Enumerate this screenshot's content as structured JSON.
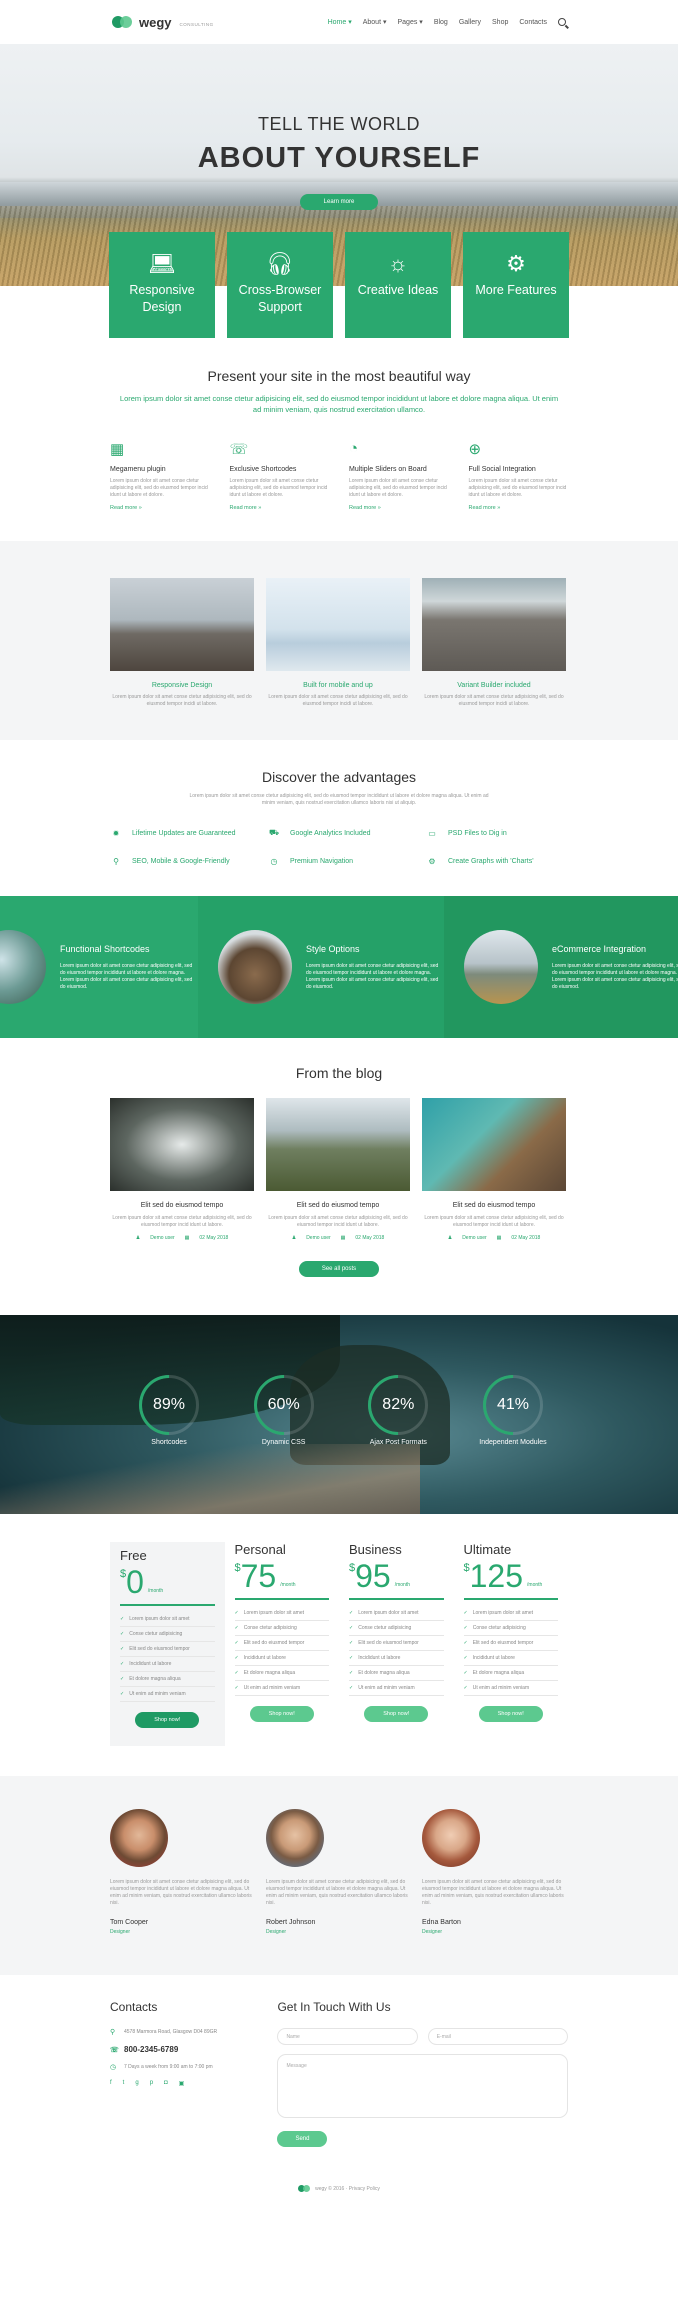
{
  "header": {
    "logo": "wegy",
    "tagline": "CONSULTING",
    "nav": [
      "Home",
      "About",
      "Pages",
      "Blog",
      "Gallery",
      "Shop",
      "Contacts"
    ]
  },
  "hero": {
    "subtitle": "TELL THE WORLD",
    "title": "ABOUT YOURSELF",
    "button": "Learn more"
  },
  "features": [
    {
      "icon": "laptop-icon",
      "label": "Responsive Design"
    },
    {
      "icon": "headphones-icon",
      "label": "Cross-Browser Support"
    },
    {
      "icon": "lightbulb-icon",
      "label": "Creative Ideas"
    },
    {
      "icon": "gear-icon",
      "label": "More Features"
    }
  ],
  "present": {
    "title": "Present your site in the most beautiful way",
    "lead": "Lorem ipsum dolor sit amet conse ctetur adipisicing elit, sed do eiusmod tempor incididunt ut labore et dolore magna aliqua. Ut enim ad minim veniam, quis nostrud exercitation ullamco.",
    "items": [
      {
        "icon": "grid-icon",
        "title": "Megamenu plugin",
        "text": "Lorem ipsum dolor sit amet conse ctetur adipisicing elit, sed do eiusmod tempor incid idunt ut labore et dolore.",
        "link": "Read more »"
      },
      {
        "icon": "shortcode-icon",
        "title": "Exclusive Shortcodes",
        "text": "Lorem ipsum dolor sit amet conse ctetur adipisicing elit, sed do eiusmod tempor incid idunt ut labore et dolore.",
        "link": "Read more »"
      },
      {
        "icon": "history-icon",
        "title": "Multiple Sliders on Board",
        "text": "Lorem ipsum dolor sit amet conse ctetur adipisicing elit, sed do eiusmod tempor incid idunt ut labore et dolore.",
        "link": "Read more »"
      },
      {
        "icon": "globe-icon",
        "title": "Full Social Integration",
        "text": "Lorem ipsum dolor sit amet conse ctetur adipisicing elit, sed do eiusmod tempor incid idunt ut labore et dolore.",
        "link": "Read more »"
      }
    ]
  },
  "gallery": [
    {
      "title": "Responsive Design",
      "text": "Lorem ipsum dolor sit amet conse ctetur adipisicing elit, sed do eiusmod tempor incidi ut labore."
    },
    {
      "title": "Built for mobile and up",
      "text": "Lorem ipsum dolor sit amet conse ctetur adipisicing elit, sed do eiusmod tempor incidi ut labore."
    },
    {
      "title": "Variant Builder included",
      "text": "Lorem ipsum dolor sit amet conse ctetur adipisicing elit, sed do eiusmod tempor incidi ut labore."
    }
  ],
  "advantages": {
    "title": "Discover the advantages",
    "desc": "Lorem ipsum dolor sit amet conse ctetur adipisicing elit, sed do eiusmod tempor incididunt ut labore et dolore magna aliqua. Ut enim ad minim veniam, quis nostrud exercitation ullamco laboris nisi ut aliquip.",
    "items": [
      {
        "icon": "star-icon",
        "label": "Lifetime Updates are Guaranteed"
      },
      {
        "icon": "cart-icon",
        "label": "Google Analytics Included"
      },
      {
        "icon": "monitor-icon",
        "label": "PSD Files to Dig in"
      },
      {
        "icon": "pin-icon",
        "label": "SEO, Mobile & Google-Friendly"
      },
      {
        "icon": "clock-icon",
        "label": "Premium Navigation"
      },
      {
        "icon": "chart-icon",
        "label": "Create Graphs with 'Charts'"
      }
    ]
  },
  "slider": [
    {
      "title": "Functional Shortcodes",
      "text": "Lorem ipsum dolor sit amet conse ctetur adipisicing elit, sed do eiusmod tempor incididunt ut labore et dolore magna. Lorem ipsum dolor sit amet conse ctetur adipisicing elit, sed do eiusmod."
    },
    {
      "title": "Style Options",
      "text": "Lorem ipsum dolor sit amet conse ctetur adipisicing elit, sed do eiusmod tempor incididunt ut labore et dolore magna. Lorem ipsum dolor sit amet conse ctetur adipisicing elit, sed do eiusmod."
    },
    {
      "title": "eCommerce Integration",
      "text": "Lorem ipsum dolor sit amet conse ctetur adipisicing elit, sed do eiusmod tempor incididunt ut labore et dolore magna. Lorem ipsum dolor sit amet conse ctetur adipisicing elit, sed do eiusmod."
    }
  ],
  "blog": {
    "title": "From the blog",
    "posts": [
      {
        "title": "Elit sed do eiusmod tempo",
        "text": "Lorem ipsum dolor sit amet conse ctetur adipisicing elit, sed do eiusmod tempor incid idunt ut labore.",
        "author": "Demo user",
        "date": "02 May 2018"
      },
      {
        "title": "Elit sed do eiusmod tempo",
        "text": "Lorem ipsum dolor sit amet conse ctetur adipisicing elit, sed do eiusmod tempor incid idunt ut labore.",
        "author": "Demo user",
        "date": "02 May 2018"
      },
      {
        "title": "Elit sed do eiusmod tempo",
        "text": "Lorem ipsum dolor sit amet conse ctetur adipisicing elit, sed do eiusmod tempor incid idunt ut labore.",
        "author": "Demo user",
        "date": "02 May 2018"
      }
    ],
    "button": "See all posts"
  },
  "stats": [
    {
      "value": "89%",
      "label": "Shortcodes"
    },
    {
      "value": "60%",
      "label": "Dynamic CSS"
    },
    {
      "value": "82%",
      "label": "Ajax Post Formats"
    },
    {
      "value": "41%",
      "label": "Independent Modules"
    }
  ],
  "pricing": [
    {
      "name": "Free",
      "currency": "$",
      "amount": "0",
      "per": "/month",
      "button": "Shop now!"
    },
    {
      "name": "Personal",
      "currency": "$",
      "amount": "75",
      "per": "/month",
      "button": "Shop now!"
    },
    {
      "name": "Business",
      "currency": "$",
      "amount": "95",
      "per": "/month",
      "button": "Shop now!"
    },
    {
      "name": "Ultimate",
      "currency": "$",
      "amount": "125",
      "per": "/month",
      "button": "Shop now!"
    }
  ],
  "pricing_features": [
    "Lorem ipsum dolor sit amet",
    "Conse ctetur adipisicing",
    "Elit sed do eiusmod tempor",
    "Incididunt ut labore",
    "Et dolore magna aliqua",
    "Ut enim ad minim veniam"
  ],
  "team": [
    {
      "name": "Tom Cooper",
      "role": "Designer",
      "text": "Lorem ipsum dolor sit amet conse ctetur adipisicing elit, sed do eiusmod tempor incididunt ut labore et dolore magna aliqua. Ut enim ad minim veniam, quis nostrud exercitation ullamco laboris nisi."
    },
    {
      "name": "Robert Johnson",
      "role": "Designer",
      "text": "Lorem ipsum dolor sit amet conse ctetur adipisicing elit, sed do eiusmod tempor incididunt ut labore et dolore magna aliqua. Ut enim ad minim veniam, quis nostrud exercitation ullamco laboris nisi."
    },
    {
      "name": "Edna Barton",
      "role": "Designer",
      "text": "Lorem ipsum dolor sit amet conse ctetur adipisicing elit, sed do eiusmod tempor incididunt ut labore et dolore magna aliqua. Ut enim ad minim veniam, quis nostrud exercitation ullamco laboris nisi."
    }
  ],
  "contacts": {
    "title": "Contacts",
    "address": "4578 Marmora Road, Glasgow D04 89GR",
    "phone": "800-2345-6789",
    "hours": "7 Days a week from 9:00 am to 7:00 pm",
    "form_title": "Get In Touch With Us",
    "name_ph": "Name",
    "email_ph": "E-mail",
    "message_ph": "Message",
    "send": "Send"
  },
  "footer": {
    "text": "wegy © 2016 · Privacy Policy"
  }
}
